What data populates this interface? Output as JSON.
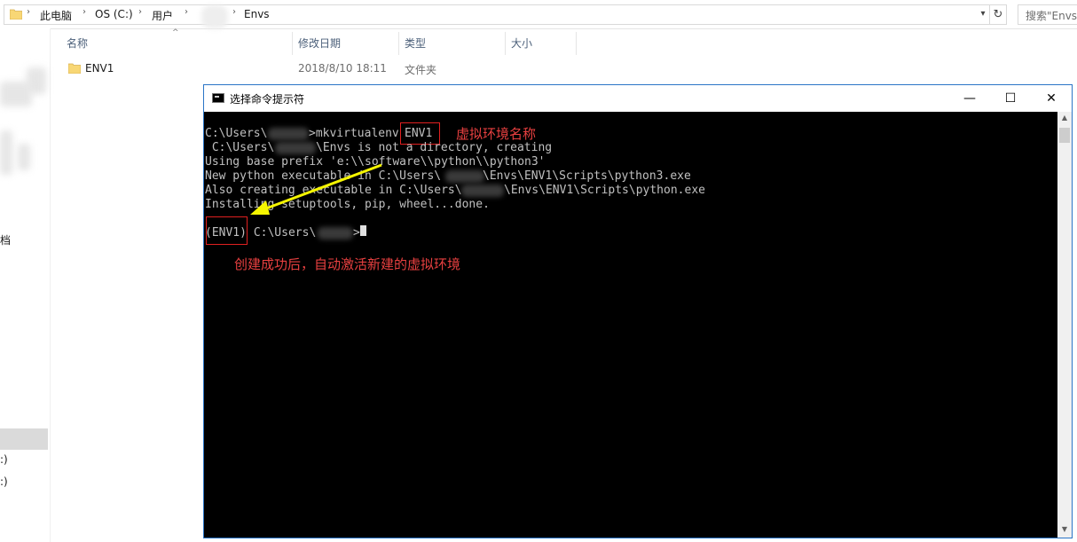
{
  "explorer": {
    "breadcrumbs": [
      "此电脑",
      "OS (C:)",
      "用户",
      "Envs"
    ],
    "search_placeholder": "搜索\"Envs\"",
    "columns": {
      "name": "名称",
      "modified": "修改日期",
      "type": "类型",
      "size": "大小"
    },
    "files": [
      {
        "name": "ENV1",
        "modified": "2018/8/10 18:11",
        "type": "文件夹",
        "size": ""
      }
    ],
    "nav_fragments": [
      "档",
      ":)",
      ":)"
    ]
  },
  "console": {
    "title": "选择命令提示符",
    "controls": {
      "minimize": "—",
      "maximize": "☐",
      "close": "✕"
    },
    "lines": {
      "l1_a": "C:\\Users\\",
      "l1_b": ">mkvirtualenv ",
      "l1_c": "ENV1",
      "l2_a": " C:\\Users\\",
      "l2_b": "\\Envs is not a directory, creating",
      "l3": "Using base prefix 'e:\\\\software\\\\python\\\\python3'",
      "l4_a": "New python executable in C:\\Users\\",
      "l4_b": "\\Envs\\ENV1\\Scripts\\python3.exe",
      "l5_a": "Also creating executable in C:\\Users\\",
      "l5_b": "\\Envs\\ENV1\\Scripts\\python.exe",
      "l6": "Installing setuptools, pip, wheel...done.",
      "l7_a": "(ENV1)",
      "l7_b": " C:\\Users\\",
      "l7_c": ">"
    },
    "annotations": {
      "env_name": "虚拟环境名称",
      "activated": "创建成功后，自动激活新建的虚拟环境"
    },
    "colors": {
      "annotation": "#e84040",
      "arrow": "#f5f500",
      "text": "#c0c0c0"
    }
  }
}
